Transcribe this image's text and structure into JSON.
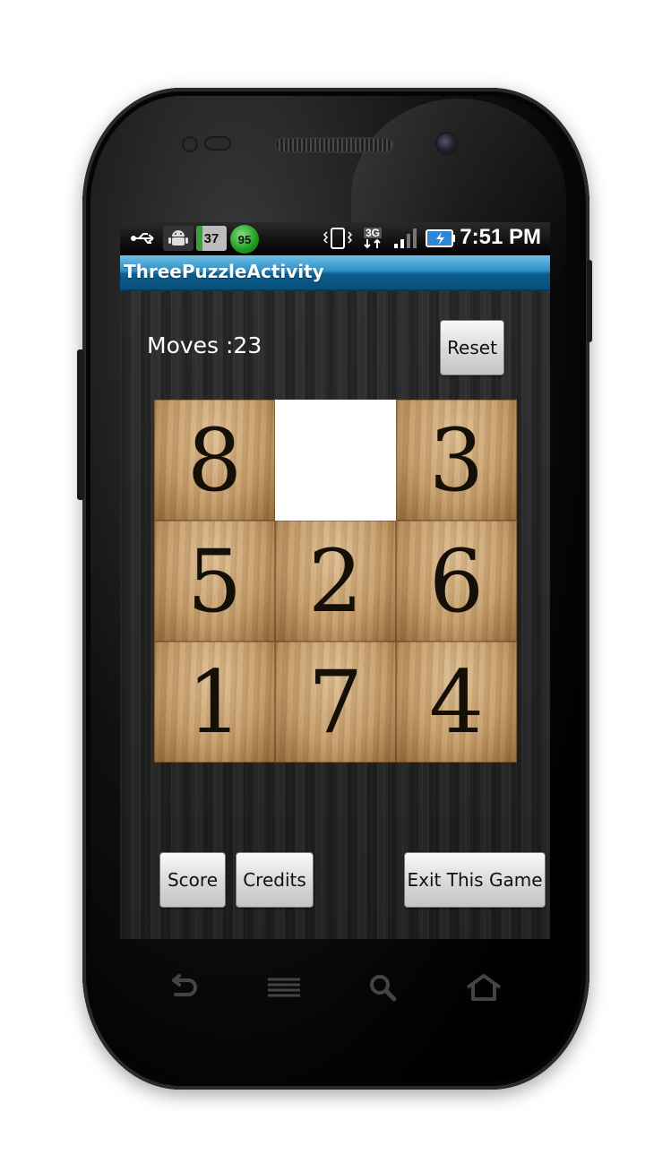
{
  "status_bar": {
    "time": "7:51 PM",
    "badge_gray": "37",
    "badge_green": "95",
    "network": "3G"
  },
  "app": {
    "title": "ThreePuzzleActivity"
  },
  "game": {
    "moves_text": "Moves :23",
    "reset_label": "Reset",
    "tiles": [
      "8",
      "",
      "3",
      "5",
      "2",
      "6",
      "1",
      "7",
      "4"
    ]
  },
  "buttons": {
    "score_label": "Score",
    "credits_label": "Credits",
    "exit_label": "Exit This Game"
  },
  "nav": {
    "icons": [
      "back-icon",
      "menu-icon",
      "search-icon",
      "home-icon"
    ]
  },
  "colors": {
    "title_bar": "#0b5e8e",
    "tile_wood": "#c59d6a",
    "empty_tile": "#ffffff"
  }
}
